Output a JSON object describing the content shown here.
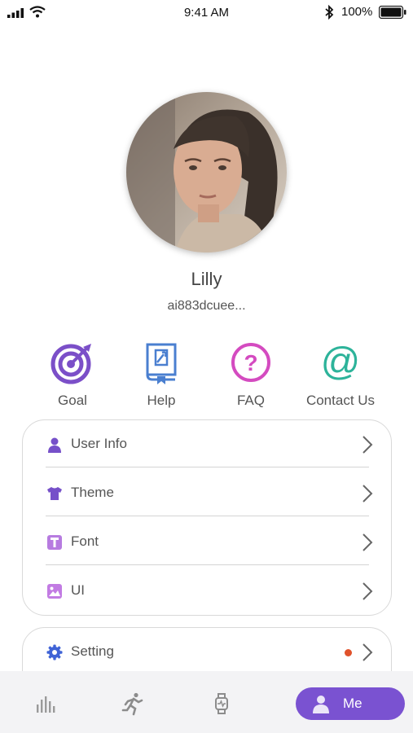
{
  "status_bar": {
    "time": "9:41 AM",
    "battery": "100%"
  },
  "profile": {
    "name": "Lilly",
    "id": "ai883dcuee..."
  },
  "quick_actions": [
    {
      "label": "Goal",
      "icon": "target-icon",
      "color": "#7b4fc8"
    },
    {
      "label": "Help",
      "icon": "help-book-icon",
      "color": "#4a7fd0"
    },
    {
      "label": "FAQ",
      "icon": "question-icon",
      "color": "#d44bc0"
    },
    {
      "label": "Contact Us",
      "icon": "at-icon",
      "color": "#2db39a"
    }
  ],
  "menu": [
    {
      "label": "User Info",
      "icon": "user-icon"
    },
    {
      "label": "Theme",
      "icon": "shirt-icon"
    },
    {
      "label": "Font",
      "icon": "font-icon"
    },
    {
      "label": "UI",
      "icon": "image-icon"
    }
  ],
  "settings": {
    "label": "Setting",
    "icon": "gear-icon",
    "has_notification": true
  },
  "tabbar": {
    "tabs": [
      {
        "icon": "chart-bars-icon"
      },
      {
        "icon": "running-icon"
      },
      {
        "icon": "watch-icon"
      }
    ],
    "active": {
      "label": "Me",
      "icon": "person-icon"
    }
  },
  "colors": {
    "accent": "#7a52d1",
    "notification": "#e0522b"
  }
}
